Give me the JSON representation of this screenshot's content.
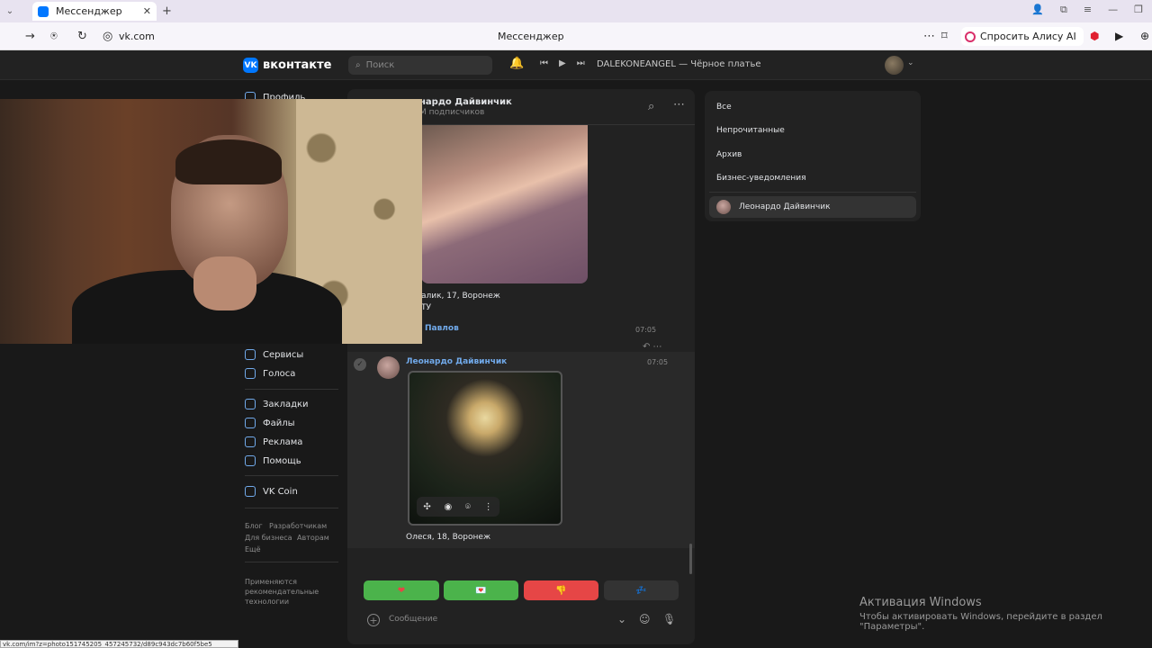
{
  "browser": {
    "tab_title": "Мессенджер",
    "url": "vk.com",
    "page_title": "Мессенджер",
    "alisa_label": "Спросить Алису AI",
    "status_url": "vk.com/im?z=photo151745205_457245732/d89c943dc7b60f5be5"
  },
  "header": {
    "logo_text": "вконтакте",
    "search_placeholder": "Поиск",
    "track": "DALEKONEANGEL — Чёрное платье"
  },
  "left_menu": {
    "profile": "Профиль",
    "items": [
      "Сервисы",
      "Голоса",
      "Закладки",
      "Файлы",
      "Реклама",
      "Помощь",
      "VK Coin"
    ],
    "footer_links": [
      "Блог",
      "Разработчикам",
      "Для бизнеса",
      "Авторам",
      "Ещё"
    ],
    "footer_note_1": "Применяются",
    "footer_note_2": "рекомендательные",
    "footer_note_3": "технологии"
  },
  "chat": {
    "name": "нардо Дайвинчик",
    "subscribers": "M подписчиков",
    "caption1_line1": "алик, 17, Воронеж",
    "caption1_line2": "ТУ",
    "sender_pavlov": "Павлов",
    "time1": "07:05",
    "sender2": "Леонардо Дайвинчик",
    "time2": "07:05",
    "caption2": "Олеся, 18, Воронеж",
    "message_placeholder": "Сообщение"
  },
  "keyboard": {
    "buttons": [
      {
        "icon": "❤",
        "bg": "#4bb34b"
      },
      {
        "icon": "💌",
        "bg": "#4bb34b"
      },
      {
        "icon": "👎",
        "bg": "#e64646"
      },
      {
        "icon": "💤",
        "bg": "#333333"
      }
    ]
  },
  "folders": {
    "items": [
      "Все",
      "Непрочитанные",
      "Архив",
      "Бизнес-уведомления"
    ],
    "active_chat": "Леонардо Дайвинчик"
  },
  "windows": {
    "activation_title": "Активация Windows",
    "activation_text": "Чтобы активировать Windows, перейдите в раздел \"Параметры\"."
  }
}
